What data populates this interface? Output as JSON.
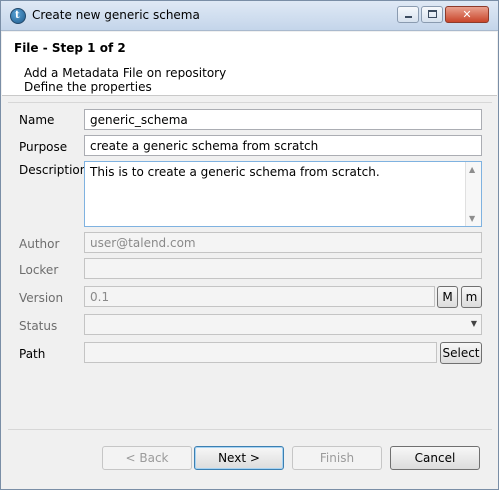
{
  "window": {
    "title": "Create new generic schema",
    "controls": {
      "minimize": "",
      "maximize": "",
      "close": "✕"
    }
  },
  "header": {
    "step_title": "File - Step 1 of 2",
    "description_lines": [
      "Add a Metadata File on repository",
      "Define the properties"
    ]
  },
  "form": {
    "name": {
      "label": "Name",
      "value": "generic_schema"
    },
    "purpose": {
      "label": "Purpose",
      "value": "create a generic schema from scratch"
    },
    "description": {
      "label": "Description",
      "value": "This is to create a generic schema from scratch."
    },
    "author": {
      "label": "Author",
      "value": "user@talend.com"
    },
    "locker": {
      "label": "Locker",
      "value": ""
    },
    "version": {
      "label": "Version",
      "value": "0.1",
      "major_button": "M",
      "minor_button": "m"
    },
    "status": {
      "label": "Status",
      "value": ""
    },
    "path": {
      "label": "Path",
      "value": "",
      "select_button": "Select"
    }
  },
  "footer": {
    "back": "< Back",
    "next": "Next >",
    "finish": "Finish",
    "cancel": "Cancel"
  },
  "icons": {
    "app": "talend-icon",
    "scroll_up": "▲",
    "scroll_down": "▼",
    "combo": "▼"
  }
}
